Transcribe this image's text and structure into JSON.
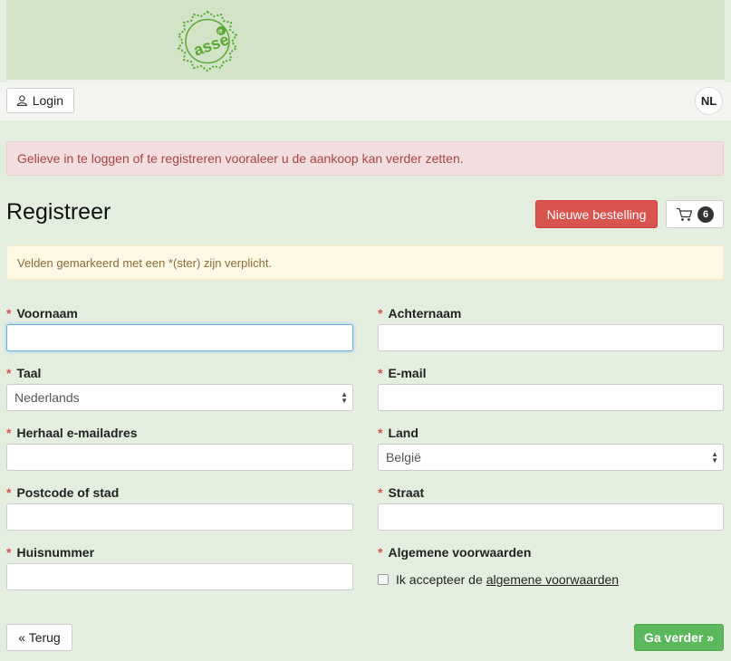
{
  "brand": {
    "logo_text": "asse",
    "logo_sup": "dt"
  },
  "topbar": {
    "login_label": "Login",
    "language": "NL"
  },
  "alert_text": "Gelieve in te loggen of te registreren vooraleer u de aankoop kan verder zetten.",
  "page_title": "Registreer",
  "actions": {
    "new_order_label": "Nieuwe bestelling",
    "cart_count": "6"
  },
  "notice_text": "Velden gemarkeerd met een *(ster) zijn verplicht.",
  "required_marker": "*",
  "form": {
    "voornaam_label": "Voornaam",
    "voornaam_value": "",
    "achternaam_label": "Achternaam",
    "achternaam_value": "",
    "taal_label": "Taal",
    "taal_value": "Nederlands",
    "email_label": "E-mail",
    "email_value": "",
    "herhaal_label": "Herhaal e-mailadres",
    "herhaal_value": "",
    "land_label": "Land",
    "land_value": "België",
    "postcode_label": "Postcode of stad",
    "postcode_value": "",
    "straat_label": "Straat",
    "straat_value": "",
    "huisnummer_label": "Huisnummer",
    "huisnummer_value": "",
    "voorwaarden_label": "Algemene voorwaarden",
    "accept_text": "Ik accepteer de",
    "accept_link": "algemene voorwaarden",
    "accept_checked": false
  },
  "footer": {
    "back_label": "« Terug",
    "next_label": "Ga verder »"
  },
  "colors": {
    "danger": "#d9534f",
    "success": "#5cb85c",
    "background": "#e4eedf",
    "banner": "#d2e3c8"
  }
}
